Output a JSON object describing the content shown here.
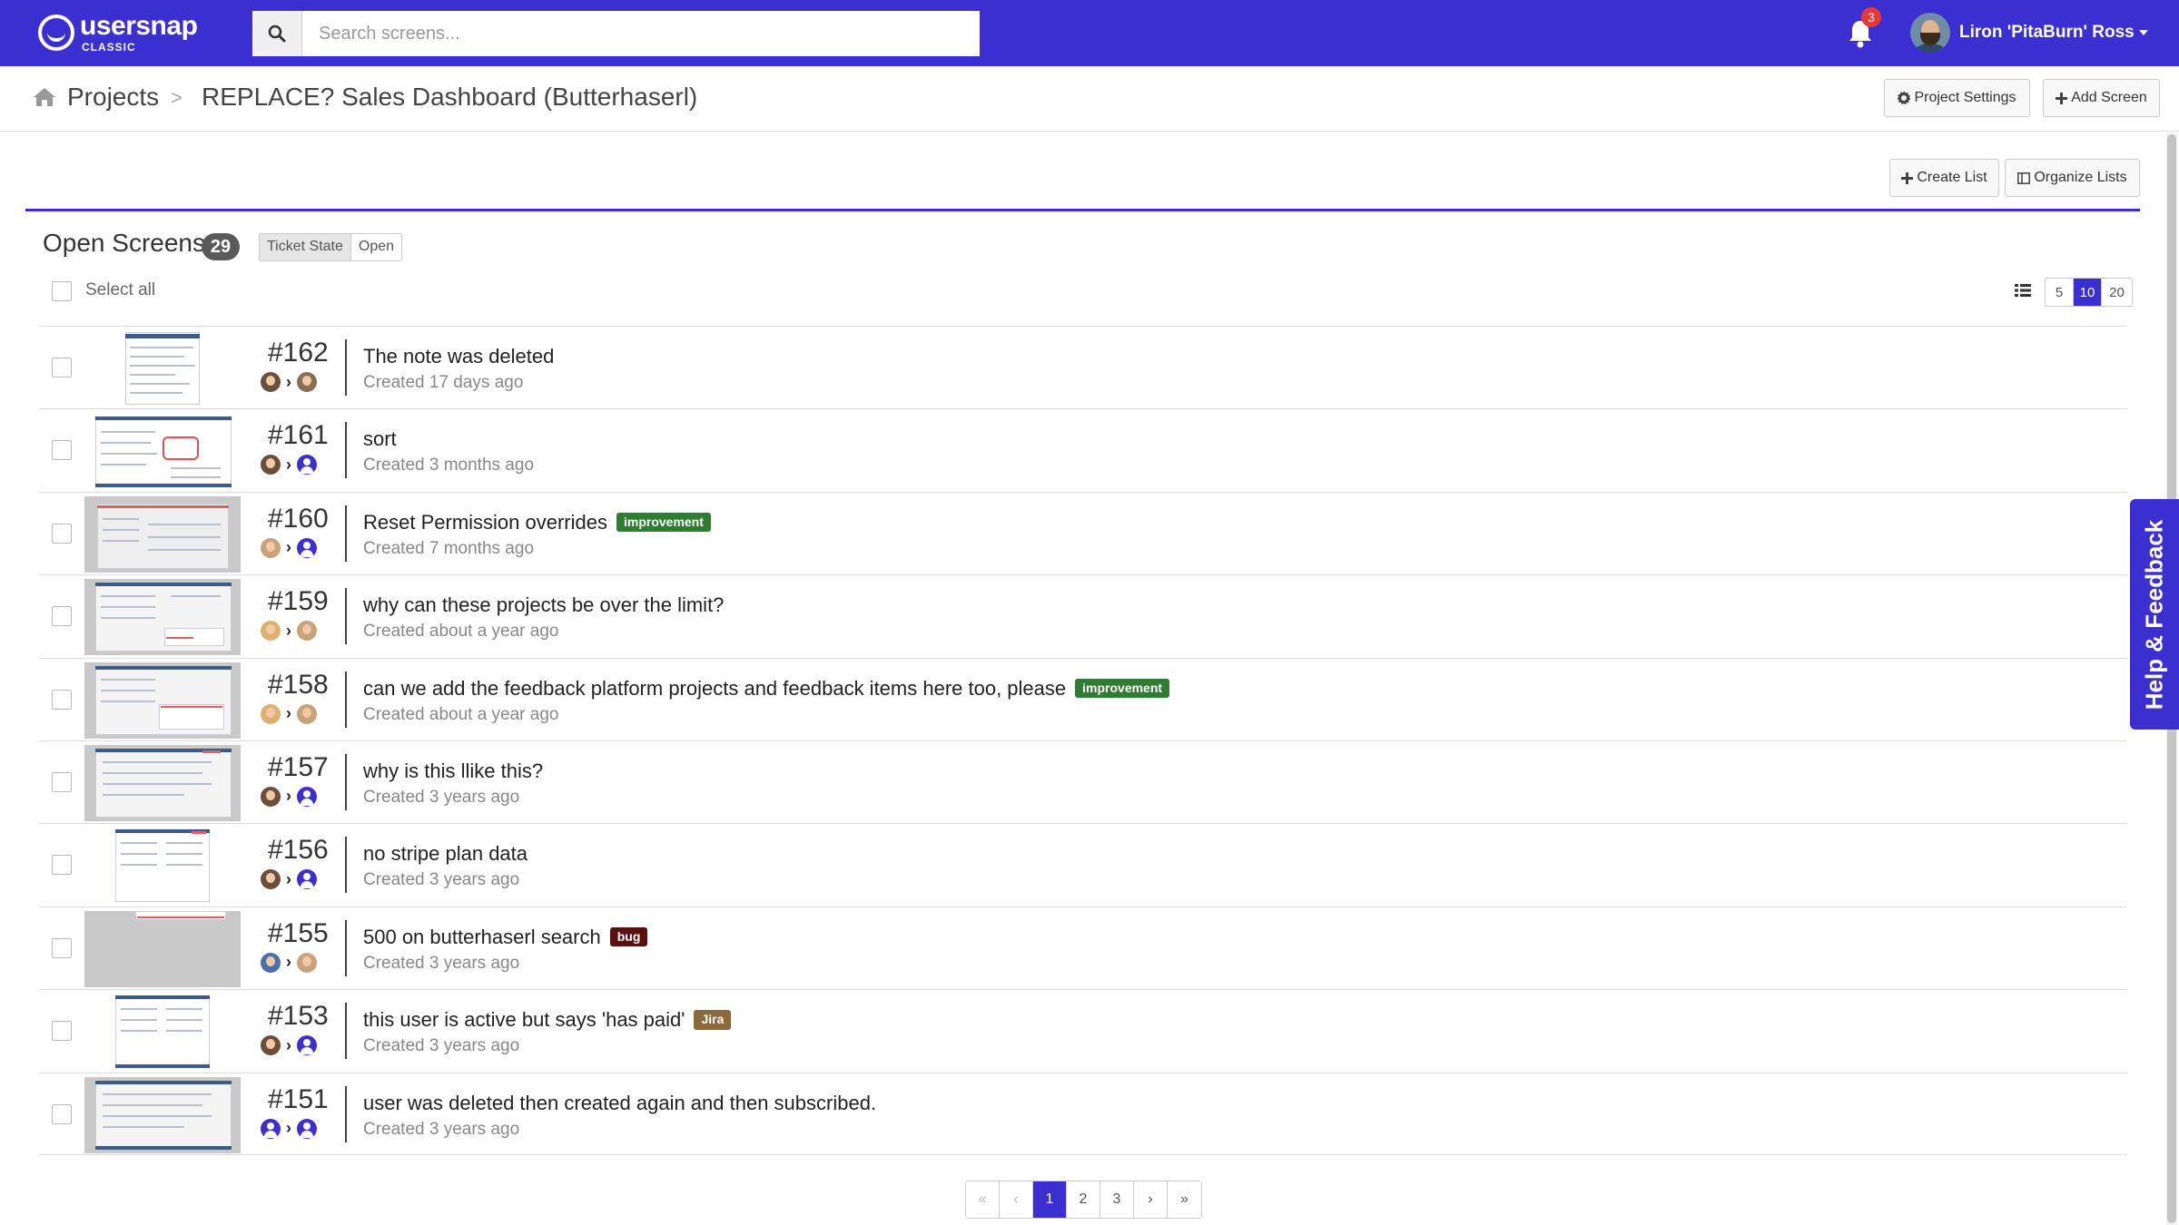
{
  "brand": {
    "name": "usersnap",
    "sub": "CLASSIC"
  },
  "search": {
    "placeholder": "Search screens..."
  },
  "notifications": {
    "count": "3"
  },
  "user": {
    "name": "Liron 'PitaBurn' Ross"
  },
  "breadcrumb": {
    "root": "Projects",
    "separator": ">",
    "current": "REPLACE? Sales Dashboard (Butterhaserl)"
  },
  "toolbar": {
    "project_settings": "Project Settings",
    "add_screen": "Add Screen"
  },
  "list_toolbar": {
    "create_list": "Create List",
    "organize_lists": "Organize Lists"
  },
  "list": {
    "title": "Open Screens",
    "count": "29",
    "filter_key": "Ticket State",
    "filter_value": "Open",
    "select_all": "Select all",
    "page_sizes": [
      "5",
      "10",
      "20"
    ],
    "active_page_size": "10"
  },
  "items": [
    {
      "number": "#162",
      "title": "The note was deleted",
      "created": "Created 17 days ago",
      "tag": "",
      "tag_color": ""
    },
    {
      "number": "#161",
      "title": "sort",
      "created": "Created 3 months ago",
      "tag": "",
      "tag_color": ""
    },
    {
      "number": "#160",
      "title": "Reset Permission overrides",
      "created": "Created 7 months ago",
      "tag": "improvement",
      "tag_color": "#2e7d32"
    },
    {
      "number": "#159",
      "title": "why can these projects be over the limit?",
      "created": "Created about a year ago",
      "tag": "",
      "tag_color": ""
    },
    {
      "number": "#158",
      "title": "can we add the feedback platform projects and feedback items here too, please",
      "created": "Created about a year ago",
      "tag": "improvement",
      "tag_color": "#2e7d32"
    },
    {
      "number": "#157",
      "title": "why is this llike this?",
      "created": "Created 3 years ago",
      "tag": "",
      "tag_color": ""
    },
    {
      "number": "#156",
      "title": "no stripe plan data",
      "created": "Created 3 years ago",
      "tag": "",
      "tag_color": ""
    },
    {
      "number": "#155",
      "title": "500 on butterhaserl search",
      "created": "Created 3 years ago",
      "tag": "bug",
      "tag_color": "#5b1010"
    },
    {
      "number": "#153",
      "title": "this user is active but says 'has paid'",
      "created": "Created 3 years ago",
      "tag": "Jira",
      "tag_color": "#8a6a3a"
    },
    {
      "number": "#151",
      "title": "user was deleted then created again and then subscribed.",
      "created": "Created 3 years ago",
      "tag": "",
      "tag_color": ""
    }
  ],
  "pagination": {
    "first": "«",
    "prev": "‹",
    "pages": [
      "1",
      "2",
      "3"
    ],
    "active": "1",
    "next": "›",
    "last": "»"
  },
  "help": {
    "label": "Help & Feedback"
  },
  "colors": {
    "primary": "#3b2fd1",
    "improvement": "#2e7d32",
    "bug": "#5b1010",
    "jira": "#8a6a3a"
  }
}
